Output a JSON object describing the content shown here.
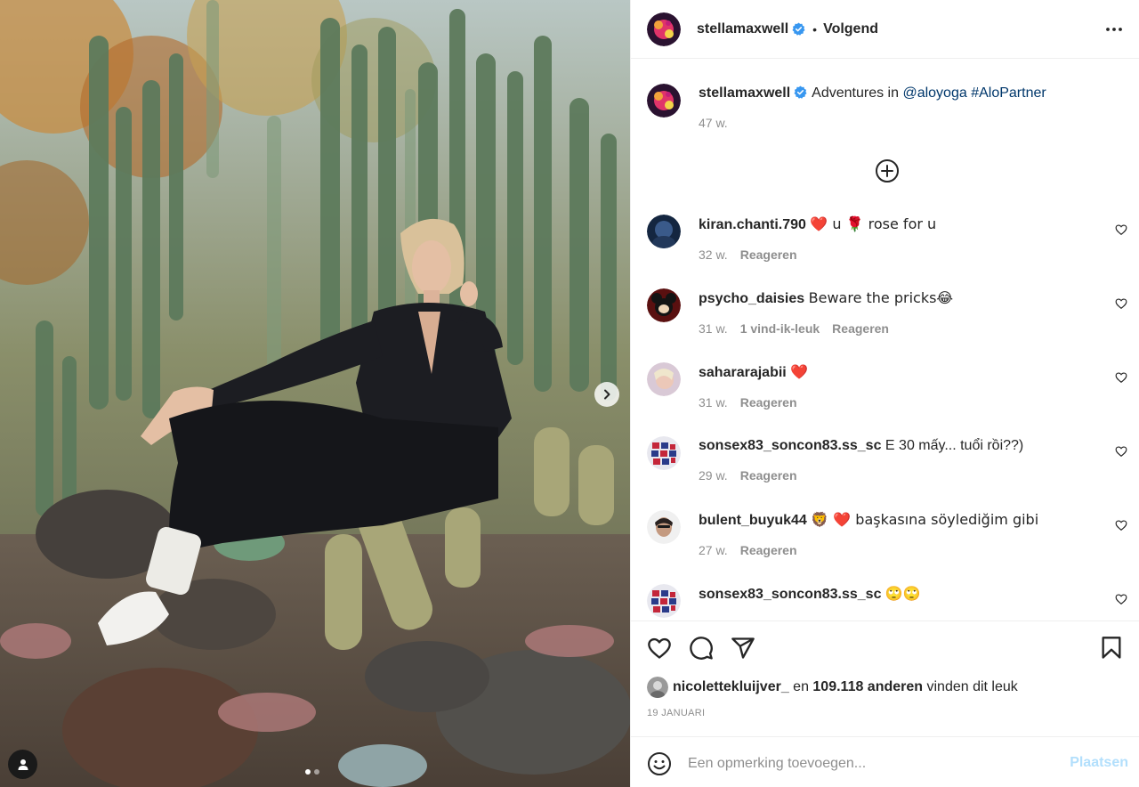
{
  "post": {
    "author": "stellamaxwell",
    "follow_state": "Volgend",
    "separator": "•"
  },
  "caption": {
    "username": "stellamaxwell",
    "text_before": "Adventures in ",
    "mention": "@aloyoga",
    "hashtag": "#AloPartner",
    "time": "47 w."
  },
  "comments": [
    {
      "username": "kiran.chanti.790",
      "text": "❤️ u 🌹 rose for u",
      "time": "32 w.",
      "likes": "",
      "reply": "Reageren"
    },
    {
      "username": "psycho_daisies",
      "text": "Beware the pricks😂",
      "time": "31 w.",
      "likes": "1 vind-ik-leuk",
      "reply": "Reageren"
    },
    {
      "username": "sahararajabii",
      "text": "❤️",
      "time": "31 w.",
      "likes": "",
      "reply": "Reageren"
    },
    {
      "username": "sonsex83_soncon83.ss_sc",
      "text": "E 30 mấy... tuổi rồi??)",
      "time": "29 w.",
      "likes": "",
      "reply": "Reageren"
    },
    {
      "username": "bulent_buyuk44",
      "text": "🦁 ❤️ başkasına söylediğim gibi",
      "time": "27 w.",
      "likes": "",
      "reply": "Reageren"
    },
    {
      "username": "sonsex83_soncon83.ss_sc",
      "text": "🙄🙄",
      "time": "",
      "likes": "",
      "reply": ""
    }
  ],
  "likes": {
    "liker": "nicolettekluijver_",
    "middle": " en ",
    "count": "109.118 anderen",
    "suffix": " vinden dit leuk"
  },
  "date": "19 JANUARI",
  "add_comment": {
    "placeholder": "Een opmerking toevoegen...",
    "post_label": "Plaatsen"
  },
  "icons": {
    "more": "more-horizontal-icon",
    "verified": "verified-badge-icon",
    "load_more": "plus-circle-icon",
    "like": "heart-icon",
    "comment": "comment-icon",
    "share": "share-icon",
    "save": "bookmark-icon",
    "emoji": "smiley-icon",
    "next": "chevron-right-icon",
    "tags": "user-tag-icon"
  },
  "colors": {
    "text": "#262626",
    "secondary": "#8e8e8e",
    "link": "#00376b",
    "verified": "#3897f0",
    "post_button_disabled": "#b2dffc",
    "divider": "#efefef"
  },
  "carousel": {
    "slide": 1,
    "total": 2
  }
}
